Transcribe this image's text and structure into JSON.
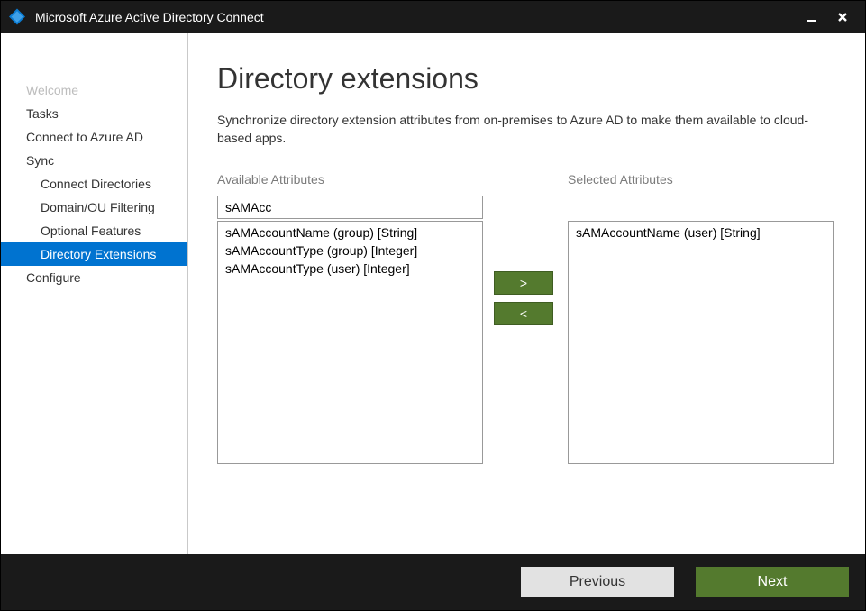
{
  "window": {
    "title": "Microsoft Azure Active Directory Connect"
  },
  "sidebar": {
    "items": [
      {
        "label": "Welcome",
        "indent": "top",
        "state": "disabled"
      },
      {
        "label": "Tasks",
        "indent": "top",
        "state": "normal"
      },
      {
        "label": "Connect to Azure AD",
        "indent": "top",
        "state": "normal"
      },
      {
        "label": "Sync",
        "indent": "top",
        "state": "normal"
      },
      {
        "label": "Connect Directories",
        "indent": "sub",
        "state": "normal"
      },
      {
        "label": "Domain/OU Filtering",
        "indent": "sub",
        "state": "normal"
      },
      {
        "label": "Optional Features",
        "indent": "sub",
        "state": "normal"
      },
      {
        "label": "Directory Extensions",
        "indent": "sub",
        "state": "active"
      },
      {
        "label": "Configure",
        "indent": "top",
        "state": "normal"
      }
    ]
  },
  "page": {
    "title": "Directory extensions",
    "description": "Synchronize directory extension attributes from on-premises to Azure AD to make them available to cloud-based apps."
  },
  "picker": {
    "available_label": "Available Attributes",
    "selected_label": "Selected Attributes",
    "search_value": "sAMAcc",
    "add_symbol": ">",
    "remove_symbol": "<",
    "available": [
      "sAMAccountName (group) [String]",
      "sAMAccountType (group) [Integer]",
      "sAMAccountType (user) [Integer]"
    ],
    "selected": [
      "sAMAccountName (user) [String]"
    ]
  },
  "footer": {
    "previous": "Previous",
    "next": "Next"
  }
}
